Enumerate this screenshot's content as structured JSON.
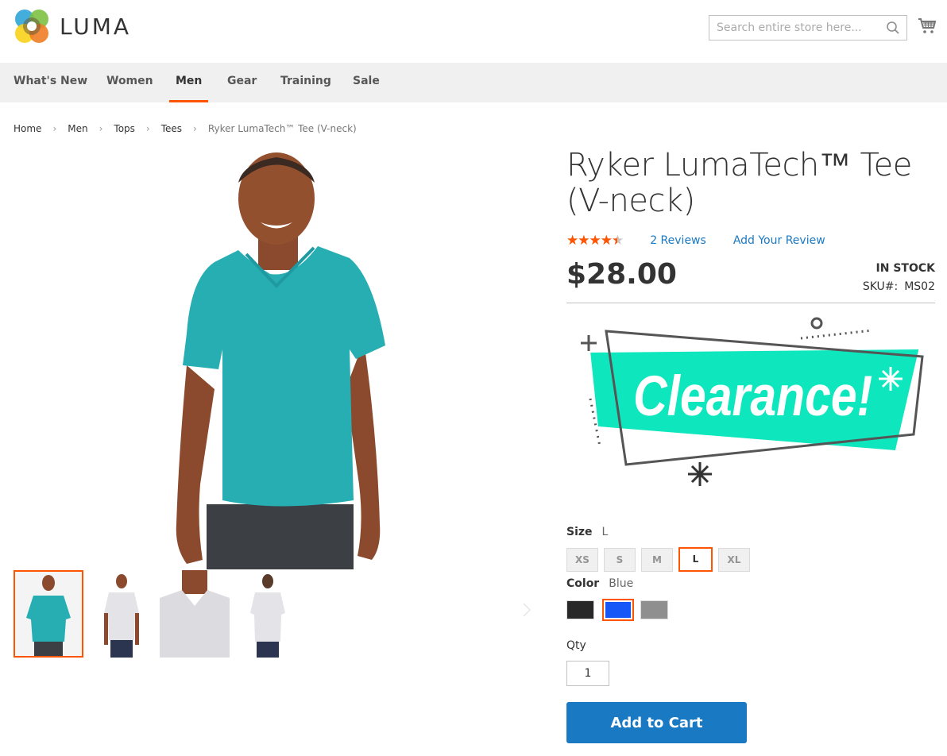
{
  "header": {
    "logo_text": "LUMA",
    "search": {
      "placeholder": "Search entire store here...",
      "value": ""
    },
    "icons": {
      "search": "search-icon",
      "cart": "cart-icon"
    }
  },
  "nav": {
    "items": [
      {
        "label": "What's New",
        "active": false
      },
      {
        "label": "Women",
        "active": false
      },
      {
        "label": "Men",
        "active": true
      },
      {
        "label": "Gear",
        "active": false
      },
      {
        "label": "Training",
        "active": false
      },
      {
        "label": "Sale",
        "active": false
      }
    ]
  },
  "breadcrumb": {
    "items": [
      "Home",
      "Men",
      "Tops",
      "Tees",
      "Ryker LumaTech™ Tee (V-neck)"
    ],
    "separator": "›"
  },
  "gallery": {
    "thumbnails": [
      {
        "name": "thumb-front-blue",
        "shirt_color": "#26aeb3",
        "active": true
      },
      {
        "name": "thumb-front-white",
        "shirt_color": "#e8e8ec",
        "active": false
      },
      {
        "name": "thumb-closeup-white",
        "shirt_color": "#e0e0e4",
        "active": false
      },
      {
        "name": "thumb-back-white",
        "shirt_color": "#e8e8ec",
        "active": false
      }
    ],
    "main_shirt_color": "#26aeb3"
  },
  "product": {
    "title": "Ryker LumaTech™ Tee (V-neck)",
    "rating_percent": 90,
    "stars_glyph": "★★★★★",
    "reviews_link": "2 Reviews",
    "add_review_link": "Add Your Review",
    "price": "$28.00",
    "stock": "In stock",
    "sku_label": "SKU#:",
    "sku": "MS02",
    "banner_text": "Clearance!"
  },
  "options": {
    "size": {
      "label": "Size",
      "selected": "L",
      "values": [
        "XS",
        "S",
        "M",
        "L",
        "XL"
      ]
    },
    "color": {
      "label": "Color",
      "selected": "Blue",
      "values": [
        {
          "name": "Black",
          "hex": "#282828"
        },
        {
          "name": "Blue",
          "hex": "#1857f7"
        },
        {
          "name": "Gray",
          "hex": "#8f8f8f"
        }
      ]
    }
  },
  "qty": {
    "label": "Qty",
    "value": "1"
  },
  "actions": {
    "add_to_cart": "Add to Cart"
  },
  "colors": {
    "accent": "#ff5501",
    "primary_button": "#1979c3",
    "link": "#1979c3",
    "banner": "#0ee6bd"
  }
}
